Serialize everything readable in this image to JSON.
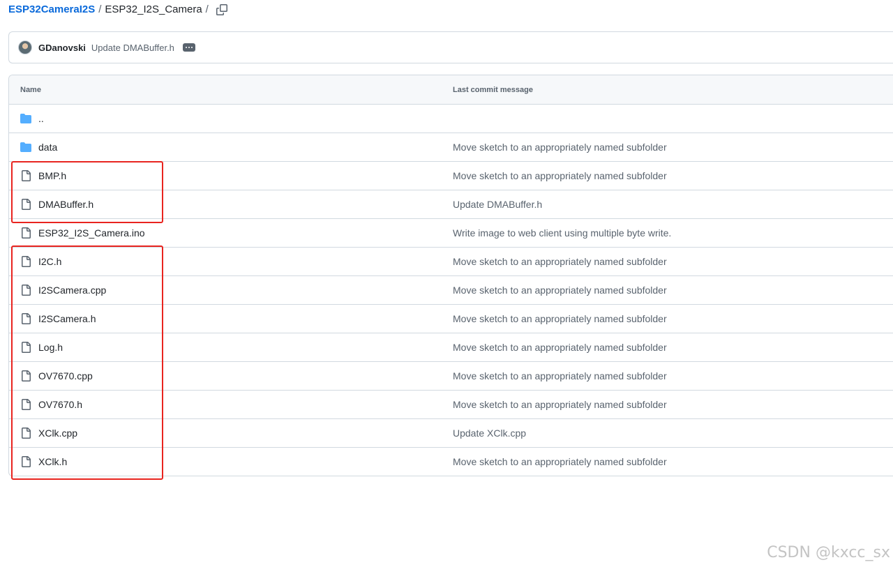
{
  "breadcrumb": {
    "repo": "ESP32CameraI2S",
    "separator": "/",
    "folder": "ESP32_I2S_Camera",
    "trailing_separator": "/",
    "copy_icon": "copy-icon"
  },
  "latest_commit": {
    "author": "GDanovski",
    "message": "Update DMABuffer.h",
    "details_icon": "kebab-horizontal-icon"
  },
  "table": {
    "headers": {
      "name": "Name",
      "last_commit": "Last commit message"
    },
    "rows": [
      {
        "type": "directory",
        "icon": "folder-icon",
        "name": "..",
        "message": ""
      },
      {
        "type": "directory",
        "icon": "folder-icon",
        "name": "data",
        "message": "Move sketch to an appropriately named subfolder"
      },
      {
        "type": "file",
        "icon": "file-icon",
        "name": "BMP.h",
        "message": "Move sketch to an appropriately named subfolder"
      },
      {
        "type": "file",
        "icon": "file-icon",
        "name": "DMABuffer.h",
        "message": "Update DMABuffer.h"
      },
      {
        "type": "file",
        "icon": "file-icon",
        "name": "ESP32_I2S_Camera.ino",
        "message": "Write image to web client using multiple byte write."
      },
      {
        "type": "file",
        "icon": "file-icon",
        "name": "I2C.h",
        "message": "Move sketch to an appropriately named subfolder"
      },
      {
        "type": "file",
        "icon": "file-icon",
        "name": "I2SCamera.cpp",
        "message": "Move sketch to an appropriately named subfolder"
      },
      {
        "type": "file",
        "icon": "file-icon",
        "name": "I2SCamera.h",
        "message": "Move sketch to an appropriately named subfolder"
      },
      {
        "type": "file",
        "icon": "file-icon",
        "name": "Log.h",
        "message": "Move sketch to an appropriately named subfolder"
      },
      {
        "type": "file",
        "icon": "file-icon",
        "name": "OV7670.cpp",
        "message": "Move sketch to an appropriately named subfolder"
      },
      {
        "type": "file",
        "icon": "file-icon",
        "name": "OV7670.h",
        "message": "Move sketch to an appropriately named subfolder"
      },
      {
        "type": "file",
        "icon": "file-icon",
        "name": "XClk.cpp",
        "message": "Update XClk.cpp"
      },
      {
        "type": "file",
        "icon": "file-icon",
        "name": "XClk.h",
        "message": "Move sketch to an appropriately named subfolder"
      }
    ]
  },
  "colors": {
    "link": "#0969da",
    "folder": "#54aeff",
    "muted_text": "#59636e",
    "border": "#d1d9e0",
    "highlight": "#e8241f"
  },
  "watermark": "CSDN @kxcc_sx"
}
